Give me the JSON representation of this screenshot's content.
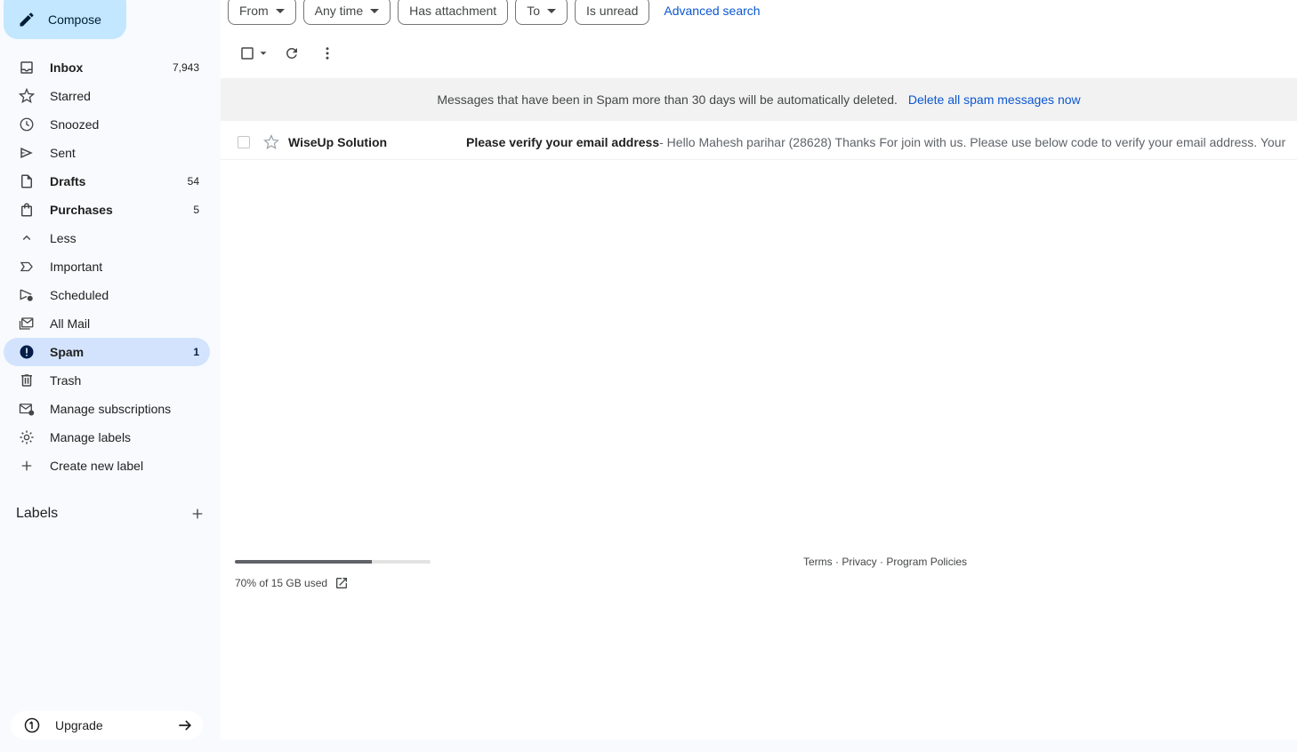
{
  "compose": {
    "label": "Compose",
    "icon": "pencil-icon"
  },
  "nav": [
    {
      "label": "Inbox",
      "count": "7,943",
      "icon": "inbox-icon",
      "bold": true
    },
    {
      "label": "Starred",
      "count": "",
      "icon": "star-icon"
    },
    {
      "label": "Snoozed",
      "count": "",
      "icon": "clock-icon"
    },
    {
      "label": "Sent",
      "count": "",
      "icon": "send-icon"
    },
    {
      "label": "Drafts",
      "count": "54",
      "icon": "draft-icon",
      "bold": true
    },
    {
      "label": "Purchases",
      "count": "5",
      "icon": "shopping-bag-icon",
      "bold": true
    },
    {
      "label": "Less",
      "count": "",
      "icon": "chevron-up-icon"
    },
    {
      "label": "Important",
      "count": "",
      "icon": "important-icon"
    },
    {
      "label": "Scheduled",
      "count": "",
      "icon": "scheduled-send-icon"
    },
    {
      "label": "All Mail",
      "count": "",
      "icon": "all-mail-icon"
    },
    {
      "label": "Spam",
      "count": "1",
      "icon": "spam-icon",
      "active": true
    },
    {
      "label": "Trash",
      "count": "",
      "icon": "trash-icon"
    },
    {
      "label": "Manage subscriptions",
      "count": "",
      "icon": "subscriptions-icon"
    },
    {
      "label": "Manage labels",
      "count": "",
      "icon": "gear-icon"
    },
    {
      "label": "Create new label",
      "count": "",
      "icon": "plus-icon"
    }
  ],
  "labels": {
    "title": "Labels"
  },
  "upgrade": {
    "label": "Upgrade"
  },
  "filters": {
    "from": "From",
    "any_time": "Any time",
    "has_attachment": "Has attachment",
    "to": "To",
    "is_unread": "Is unread",
    "advanced": "Advanced search"
  },
  "banner": {
    "message": "Messages that have been in Spam more than 30 days will be automatically deleted.",
    "action": "Delete all spam messages now"
  },
  "emails": [
    {
      "sender": "WiseUp Solution",
      "subject": "Please verify your email address",
      "snippet": " - Hello Mahesh parihar (28628) Thanks For join with us. Please use below code to verify your email address. Your"
    }
  ],
  "storage": {
    "text": "70% of 15 GB used",
    "percent_used": 70
  },
  "footer": {
    "terms": "Terms",
    "sep": " · ",
    "privacy": "Privacy",
    "policies": "Program Policies"
  },
  "colors": {
    "compose_bg": "#c2e7ff",
    "active_bg": "#d3e3fd",
    "link": "#0b57d0"
  }
}
